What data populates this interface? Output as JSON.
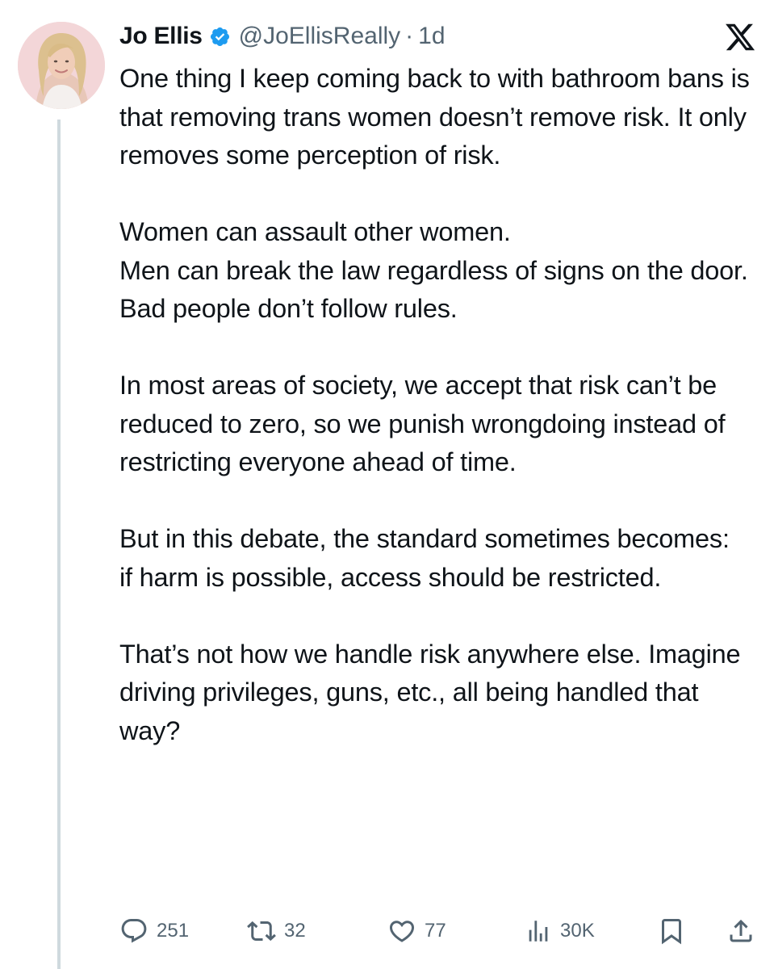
{
  "author": {
    "name": "Jo Ellis",
    "handle": "@JoEllisReally",
    "separator": "·",
    "time": "1d"
  },
  "tweet": {
    "paragraphs": [
      "One thing I keep coming back to with bathroom bans is that removing trans women doesn’t remove risk. It only removes some perception of risk.",
      "",
      "Women can assault other women.",
      "Men can break the law regardless of signs on the door.",
      "Bad people don’t follow rules.",
      "",
      "In most areas of society, we accept that risk can’t be reduced to zero, so we punish wrongdoing instead of restricting everyone ahead of time.",
      "",
      "But in this debate, the standard sometimes becomes:",
      "if harm is possible, access should be restricted.",
      "",
      "That’s not how we handle risk anywhere else. Imagine driving privileges, guns, etc., all being handled that way?"
    ]
  },
  "actions": {
    "replies": "251",
    "reposts": "32",
    "likes": "77",
    "views": "30K"
  },
  "icons": {
    "verified": "verified-badge-icon",
    "platform": "x-logo-icon",
    "reply": "reply-icon",
    "repost": "repost-icon",
    "like": "heart-icon",
    "views": "views-icon",
    "bookmark": "bookmark-icon",
    "share": "share-icon"
  },
  "colors": {
    "verified": "#1d9bf0",
    "text": "#0f1419",
    "secondary": "#536471",
    "thread_line": "#cfd9de"
  }
}
